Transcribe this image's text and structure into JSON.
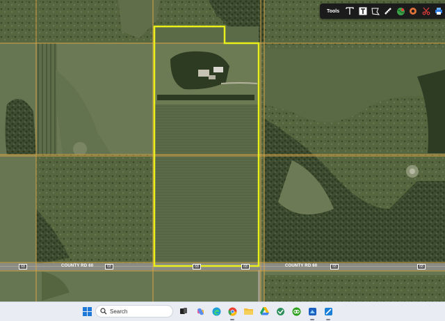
{
  "toolbar": {
    "title": "Tools",
    "tools": [
      {
        "id": "text-tool",
        "icon": "text-icon"
      },
      {
        "id": "text-box-tool",
        "icon": "text-box-icon"
      },
      {
        "id": "polygon-tool",
        "icon": "polygon-icon"
      },
      {
        "id": "measure-tool",
        "icon": "ruler-icon"
      },
      {
        "id": "location-tool",
        "icon": "globe-location-icon"
      },
      {
        "id": "buffer-tool",
        "icon": "circle-buffer-icon"
      },
      {
        "id": "cut-tool",
        "icon": "scissors-icon"
      },
      {
        "id": "print-tool",
        "icon": "print-icon"
      }
    ]
  },
  "map": {
    "road_labels": {
      "west_shield": "68",
      "county_rd_west": "COUNTY RD 60",
      "shield_2": "68",
      "shield_3": "68",
      "shield_4": "68",
      "county_rd_east": "COUNTY RD 60",
      "shield_5": "68",
      "east_shield": "68"
    },
    "colors": {
      "parcel_outline": "#e8ef1a",
      "grid_lines": "#d8a64a",
      "road_label": "#ffffff"
    }
  },
  "taskbar": {
    "search_placeholder": "Search",
    "apps": [
      "windows-start-icon",
      "search-icon",
      "task-view-icon",
      "copilot-icon",
      "edge-icon",
      "chrome-icon",
      "file-explorer-icon",
      "google-drive-icon",
      "app-icon",
      "quickbooks-icon",
      "app-icon-2",
      "app-icon-3"
    ]
  }
}
